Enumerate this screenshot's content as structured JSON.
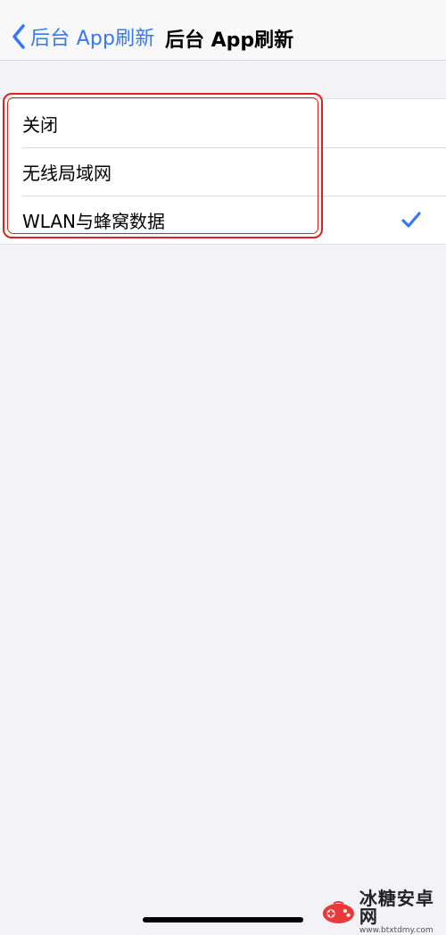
{
  "navbar": {
    "back_label": "后台 App刷新",
    "title": "后台 App刷新"
  },
  "options": [
    {
      "label": "关闭",
      "selected": false
    },
    {
      "label": "无线局域网",
      "selected": false
    },
    {
      "label": "WLAN与蜂窝数据",
      "selected": true
    }
  ],
  "watermark": {
    "name": "冰糖安卓网",
    "url": "www.btxtdmy.com"
  },
  "colors": {
    "accent": "#3478f6",
    "background": "#f2f2f7",
    "annotation": "#e02020"
  }
}
